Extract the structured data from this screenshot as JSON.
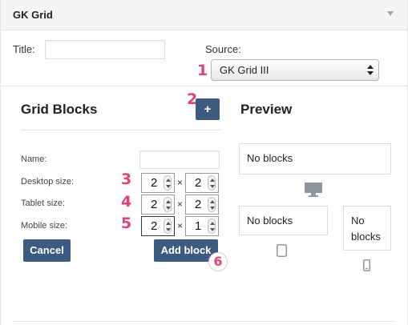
{
  "header": {
    "title": "GK Grid"
  },
  "form": {
    "title_label": "Title:",
    "title_value": "",
    "source_label": "Source:",
    "source_selected": "GK Grid III"
  },
  "grid_blocks": {
    "heading": "Grid Blocks",
    "add_label": "+",
    "name_label": "Name:",
    "name_value": "",
    "desktop_label": "Desktop size:",
    "tablet_label": "Tablet size:",
    "mobile_label": "Mobile size:",
    "times": "×",
    "desktop": {
      "w": "2",
      "h": "2"
    },
    "tablet": {
      "w": "2",
      "h": "2"
    },
    "mobile": {
      "w": "2",
      "h": "1"
    },
    "cancel_label": "Cancel",
    "add_block_label": "Add block"
  },
  "preview": {
    "heading": "Preview",
    "desktop_text": "No blocks",
    "tablet_text": "No blocks",
    "mobile_text": "No blocks"
  },
  "markers": [
    "1",
    "2",
    "3",
    "4",
    "5",
    "6"
  ],
  "colors": {
    "accent": "#3d5a80",
    "marker": "#e0417a"
  }
}
